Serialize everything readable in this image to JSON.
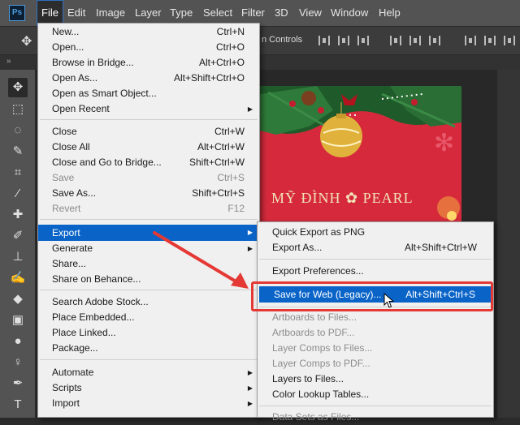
{
  "app": {
    "logo_text": "Ps"
  },
  "menubar": {
    "items": [
      "File",
      "Edit",
      "Image",
      "Layer",
      "Type",
      "Select",
      "Filter",
      "3D",
      "View",
      "Window",
      "Help"
    ]
  },
  "optionsbar": {
    "show_controls_text": "n Controls"
  },
  "artwork": {
    "brand_text": "MỸ ĐÌNH ✿ PEARL"
  },
  "file_menu": {
    "items": [
      {
        "label": "New...",
        "shortcut": "Ctrl+N"
      },
      {
        "label": "Open...",
        "shortcut": "Ctrl+O"
      },
      {
        "label": "Browse in Bridge...",
        "shortcut": "Alt+Ctrl+O"
      },
      {
        "label": "Open As...",
        "shortcut": "Alt+Shift+Ctrl+O"
      },
      {
        "label": "Open as Smart Object...",
        "shortcut": ""
      },
      {
        "label": "Open Recent",
        "shortcut": ""
      },
      {
        "label": "Close",
        "shortcut": "Ctrl+W"
      },
      {
        "label": "Close All",
        "shortcut": "Alt+Ctrl+W"
      },
      {
        "label": "Close and Go to Bridge...",
        "shortcut": "Shift+Ctrl+W"
      },
      {
        "label": "Save",
        "shortcut": "Ctrl+S"
      },
      {
        "label": "Save As...",
        "shortcut": "Shift+Ctrl+S"
      },
      {
        "label": "Revert",
        "shortcut": "F12"
      },
      {
        "label": "Export",
        "shortcut": ""
      },
      {
        "label": "Generate",
        "shortcut": ""
      },
      {
        "label": "Share...",
        "shortcut": ""
      },
      {
        "label": "Share on Behance...",
        "shortcut": ""
      },
      {
        "label": "Search Adobe Stock...",
        "shortcut": ""
      },
      {
        "label": "Place Embedded...",
        "shortcut": ""
      },
      {
        "label": "Place Linked...",
        "shortcut": ""
      },
      {
        "label": "Package...",
        "shortcut": ""
      },
      {
        "label": "Automate",
        "shortcut": ""
      },
      {
        "label": "Scripts",
        "shortcut": ""
      },
      {
        "label": "Import",
        "shortcut": ""
      }
    ]
  },
  "export_submenu": {
    "items": [
      {
        "label": "Quick Export as PNG",
        "shortcut": ""
      },
      {
        "label": "Export As...",
        "shortcut": "Alt+Shift+Ctrl+W"
      },
      {
        "label": "Export Preferences...",
        "shortcut": ""
      },
      {
        "label": "Save for Web (Legacy)...",
        "shortcut": "Alt+Shift+Ctrl+S"
      },
      {
        "label": "Artboards to Files...",
        "shortcut": ""
      },
      {
        "label": "Artboards to PDF...",
        "shortcut": ""
      },
      {
        "label": "Layer Comps to Files...",
        "shortcut": ""
      },
      {
        "label": "Layer Comps to PDF...",
        "shortcut": ""
      },
      {
        "label": "Layers to Files...",
        "shortcut": ""
      },
      {
        "label": "Color Lookup Tables...",
        "shortcut": ""
      },
      {
        "label": "Data Sets as Files...",
        "shortcut": ""
      }
    ]
  },
  "colors": {
    "highlight": "#0a64c8",
    "annotation": "#e53935",
    "artwork_red": "#d62a3c"
  }
}
